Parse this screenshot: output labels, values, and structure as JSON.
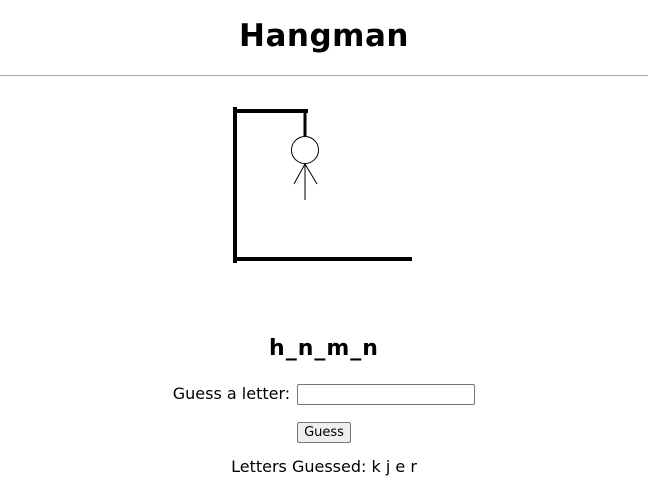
{
  "header": {
    "title": "Hangman"
  },
  "drawing": {
    "parts_shown": [
      "gallows",
      "rope",
      "head",
      "body",
      "left-arm",
      "right-arm"
    ],
    "color": "#000000"
  },
  "game": {
    "masked_word": "h_n_m_n",
    "guess_label": "Guess a letter:",
    "guess_input_value": "",
    "guess_button_label": "Guess",
    "letters_guessed_label": "Letters Guessed:",
    "letters_guessed": "k j e r"
  }
}
